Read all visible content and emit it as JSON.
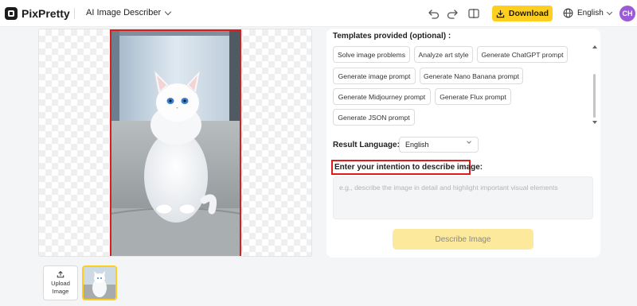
{
  "header": {
    "brand": "PixPretty",
    "tool_name": "AI Image Describer",
    "download_label": "Download",
    "language": "English",
    "avatar_initials": "CH"
  },
  "upload": {
    "label": "Upload Image"
  },
  "panel": {
    "templates_label": "Templates provided (optional) :",
    "templates": [
      "Solve image problems",
      "Analyze art style",
      "Generate ChatGPT prompt",
      "Generate image prompt",
      "Generate Nano Banana prompt",
      "Generate Midjourney prompt",
      "Generate Flux prompt",
      "Generate JSON prompt"
    ],
    "result_language_label": "Result Language:",
    "result_language_value": "English",
    "intention_label": "Enter your intention to describe image:",
    "intention_placeholder": "e.g., describe the image in detail and highlight important visual elements",
    "describe_button": "Describe Image"
  },
  "colors": {
    "accent": "#ffcf1f",
    "highlight_box": "#e01b1b",
    "avatar": "#9b5ad6"
  },
  "icons": [
    "logo-icon",
    "chevron-down-icon",
    "undo-icon",
    "redo-icon",
    "compare-icon",
    "download-icon",
    "globe-icon",
    "upload-icon"
  ]
}
